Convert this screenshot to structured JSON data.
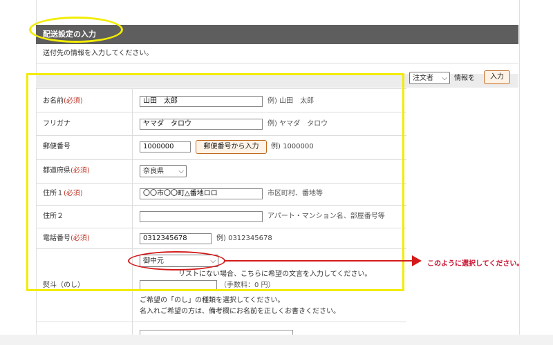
{
  "section": {
    "title": "配送設定の入力",
    "subtitle": "送付先の情報を入力してください。"
  },
  "toolbar": {
    "role_select_value": "注文者",
    "role_suffix": "情報を",
    "input_button": "入力"
  },
  "required_mark": "(必須)",
  "fields": {
    "name": {
      "label": "お名前",
      "value": "山田　太郎",
      "example": "例) 山田　太郎"
    },
    "kana": {
      "label": "フリガナ",
      "value": "ヤマダ　タロウ",
      "example": "例) ヤマダ　タロウ"
    },
    "postal": {
      "label": "郵便番号",
      "value": "1000000",
      "button": "郵便番号から入力",
      "example": "例) 1000000"
    },
    "prefecture": {
      "label": "都道府県",
      "value": "奈良県"
    },
    "address1": {
      "label": "住所１",
      "value": "〇〇市〇〇町△番地ロロ",
      "example": "市区町村、番地等"
    },
    "address2": {
      "label": "住所２",
      "value": "",
      "example": "アパート・マンション名、部屋番号等"
    },
    "phone": {
      "label": "電話番号",
      "value": "0312345678",
      "example": "例) 0312345678"
    },
    "noshi": {
      "label": "熨斗（のし）",
      "select_value": "御中元",
      "help_top": "リストにない場合、こちらに希望の文言を入力してください。",
      "fee": "（手数料：0 円）",
      "help_bottom1": "ご希望の「のし」の種類を選択してください。",
      "help_bottom2": "名入れご希望の方は、備考欄にお名前を正しくお書きください。"
    }
  },
  "annotation": {
    "note": "このように選択してください。",
    "colors": {
      "yellow": "#f2ec00",
      "red": "#d41a1a",
      "required": "#c0392b"
    }
  }
}
